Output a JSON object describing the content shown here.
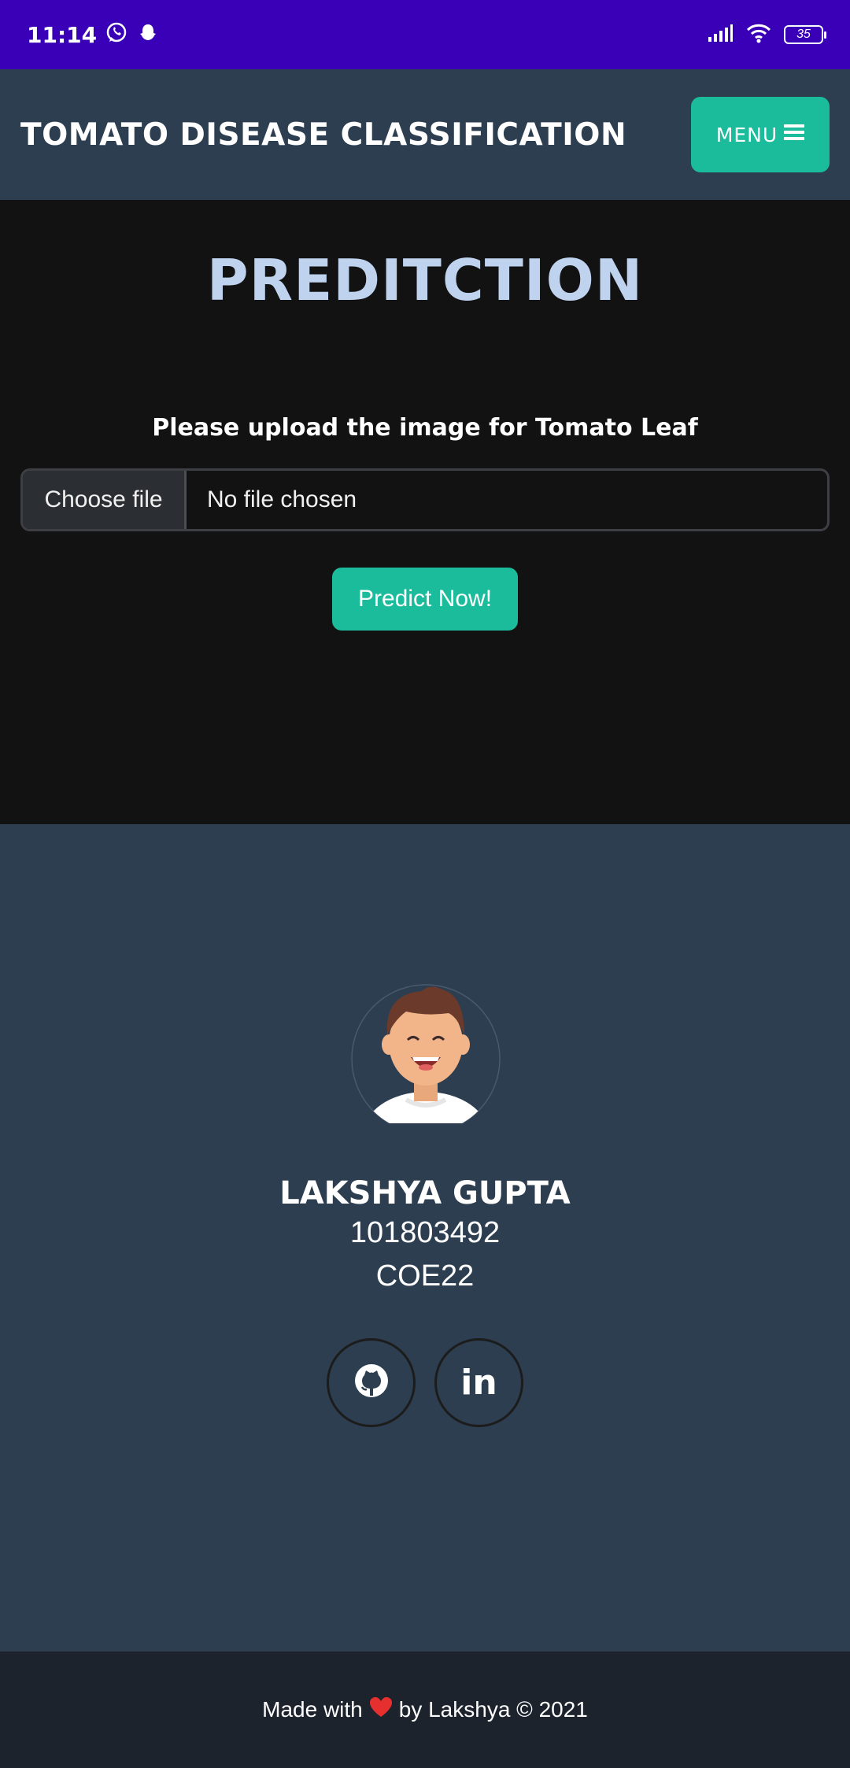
{
  "status_bar": {
    "time": "11:14",
    "battery": "35",
    "icons": [
      "whatsapp-icon",
      "snapchat-icon",
      "signal-icon",
      "wifi-icon",
      "battery-icon"
    ]
  },
  "navbar": {
    "brand": "TOMATO DISEASE CLASSIFICATION",
    "menu_label": "MENU",
    "menu_icon": "hamburger-icon"
  },
  "prediction": {
    "title": "PREDITCTION",
    "upload_label": "Please upload the image for Tomato Leaf",
    "choose_file_label": "Choose file",
    "file_status": "No file chosen",
    "predict_label": "Predict Now!"
  },
  "profile": {
    "name": "LAKSHYA GUPTA",
    "roll": "101803492",
    "group": "COE22",
    "social": [
      "github-icon",
      "linkedin-icon"
    ],
    "linkedin_text": "in"
  },
  "footer": {
    "prefix": "Made with",
    "suffix": "by Lakshya © 2021"
  },
  "colors": {
    "status_bar": "#3a00b8",
    "navbar": "#2c3e50",
    "accent": "#1abc9c",
    "title": "#bfd2ee",
    "prediction_bg": "#121212",
    "footer_bg": "#1c232d",
    "heart": "#e63030"
  }
}
